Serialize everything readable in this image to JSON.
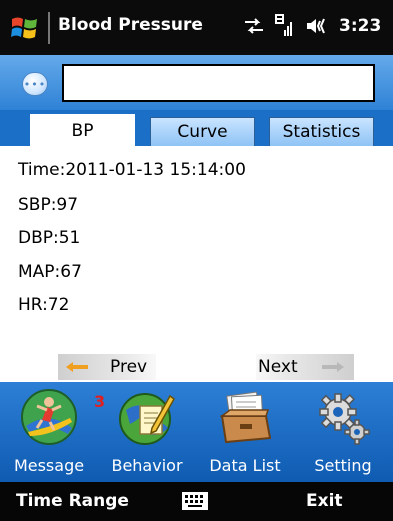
{
  "titlebar": {
    "title": "Blood Pressure",
    "time": "3:23",
    "icons": [
      "windows-start-icon",
      "data-transfer-icon",
      "signal-edge-icon",
      "volume-icon"
    ]
  },
  "input": {
    "value": "",
    "placeholder": ""
  },
  "tabs": [
    {
      "label": "BP",
      "active": true
    },
    {
      "label": "Curve",
      "active": false
    },
    {
      "label": "Statistics",
      "active": false
    }
  ],
  "record": {
    "time": "Time:2011-01-13 15:14:00",
    "sbp": "SBP:97",
    "dbp": "DBP:51",
    "map": "MAP:67",
    "hr": "HR:72"
  },
  "nav": {
    "prev": "Prev",
    "next": "Next"
  },
  "apps": [
    {
      "label": "Message",
      "icon": "surfer-icon",
      "badge": "3"
    },
    {
      "label": "Behavior",
      "icon": "globe-pencil-icon"
    },
    {
      "label": "Data List",
      "icon": "file-box-icon"
    },
    {
      "label": "Setting",
      "icon": "gears-icon"
    }
  ],
  "softkeys": {
    "left": "Time Range",
    "right": "Exit",
    "center_icon": "keyboard-icon"
  },
  "colors": {
    "accent_blue": "#1c6fc6",
    "title_bar": "#0b0b0b",
    "badge_red": "#e02020"
  }
}
